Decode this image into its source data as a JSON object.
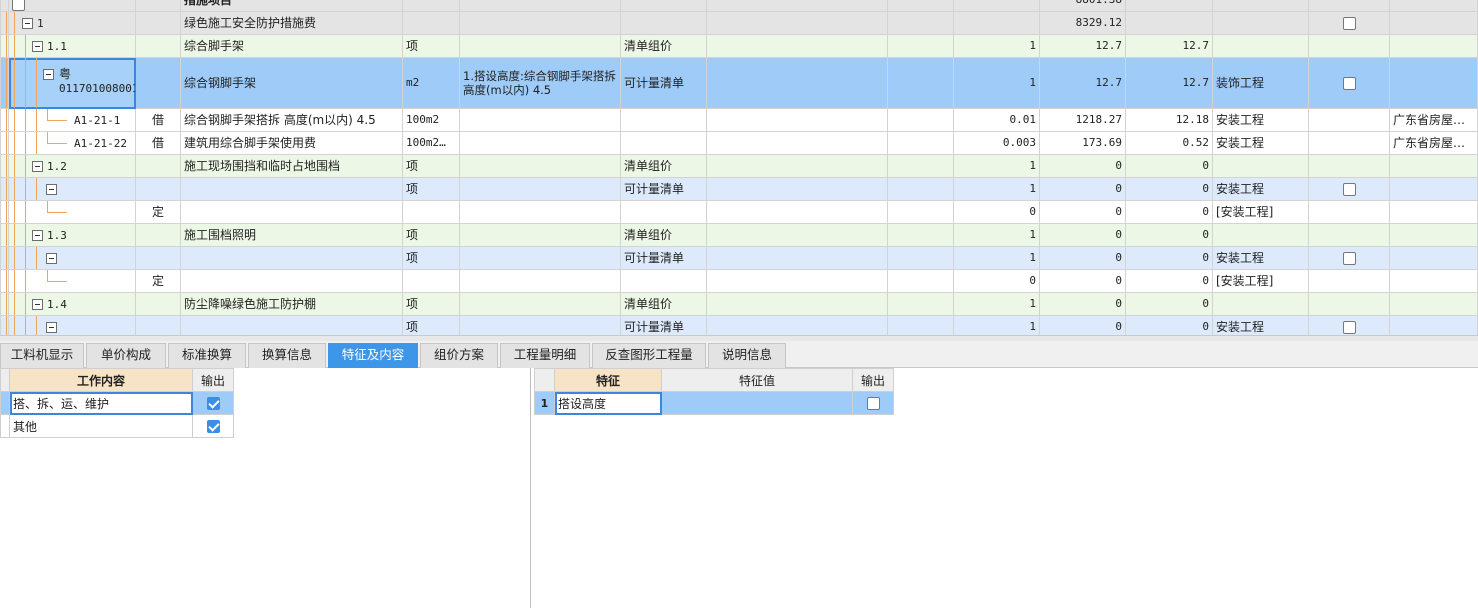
{
  "main_grid": {
    "header_row": {
      "name": "措施项目",
      "total": "8801.38"
    },
    "rows": [
      {
        "code": "1",
        "type": "",
        "name": "绿色施工安全防护措施费",
        "unit": "",
        "feature": "",
        "category": "",
        "qty": "",
        "price": "",
        "total": "8329.12",
        "discipline": "",
        "checkbox": true
      },
      {
        "code": "1.1",
        "type": "",
        "name": "综合脚手架",
        "unit": "项",
        "feature": "",
        "category": "清单组价",
        "qty": "1",
        "price": "12.7",
        "total": "12.7",
        "discipline": "",
        "checkbox": false
      },
      {
        "code": "粤011701008001",
        "code_line1": "粤",
        "code_line2": "011701008001",
        "type": "",
        "name": "综合钢脚手架",
        "unit": "m2",
        "feature": "1.搭设高度:综合钢脚手架搭拆 高度(m以内) 4.5",
        "category": "可计量清单",
        "qty": "1",
        "price": "12.7",
        "total": "12.7",
        "discipline": "装饰工程",
        "checkbox": true
      },
      {
        "code": "A1-21-1",
        "type": "借",
        "name": "综合钢脚手架搭拆 高度(m以内) 4.5",
        "unit": "100m2",
        "feature": "",
        "category": "",
        "qty": "0.01",
        "price": "1218.27",
        "total": "12.18",
        "discipline": "安装工程",
        "source": "广东省房屋…",
        "checkbox": false
      },
      {
        "code": "A1-21-22",
        "type": "借",
        "name": "建筑用综合脚手架使用费",
        "unit": "100m2…",
        "feature": "",
        "category": "",
        "qty": "0.003",
        "price": "173.69",
        "total": "0.52",
        "discipline": "安装工程",
        "source": "广东省房屋…",
        "checkbox": false
      },
      {
        "code": "1.2",
        "type": "",
        "name": "施工现场围挡和临时占地围档",
        "unit": "项",
        "feature": "",
        "category": "清单组价",
        "qty": "1",
        "price": "0",
        "total": "0",
        "discipline": "",
        "checkbox": false
      },
      {
        "code": "",
        "type": "",
        "name": "",
        "unit": "项",
        "feature": "",
        "category": "可计量清单",
        "qty": "1",
        "price": "0",
        "total": "0",
        "discipline": "安装工程",
        "checkbox": true
      },
      {
        "code": "",
        "type": "定",
        "name": "",
        "unit": "",
        "feature": "",
        "category": "",
        "qty": "0",
        "price": "0",
        "total": "0",
        "discipline": "[安装工程]",
        "checkbox": false
      },
      {
        "code": "1.3",
        "type": "",
        "name": "施工围档照明",
        "unit": "项",
        "feature": "",
        "category": "清单组价",
        "qty": "1",
        "price": "0",
        "total": "0",
        "discipline": "",
        "checkbox": false
      },
      {
        "code": "",
        "type": "",
        "name": "",
        "unit": "项",
        "feature": "",
        "category": "可计量清单",
        "qty": "1",
        "price": "0",
        "total": "0",
        "discipline": "安装工程",
        "checkbox": true
      },
      {
        "code": "",
        "type": "定",
        "name": "",
        "unit": "",
        "feature": "",
        "category": "",
        "qty": "0",
        "price": "0",
        "total": "0",
        "discipline": "[安装工程]",
        "checkbox": false
      },
      {
        "code": "1.4",
        "type": "",
        "name": "防尘降噪绿色施工防护棚",
        "unit": "项",
        "feature": "",
        "category": "清单组价",
        "qty": "1",
        "price": "0",
        "total": "0",
        "discipline": "",
        "checkbox": false
      },
      {
        "code": "",
        "type": "",
        "name": "",
        "unit": "项",
        "feature": "",
        "category": "可计量清单",
        "qty": "1",
        "price": "0",
        "total": "0",
        "discipline": "安装工程",
        "checkbox": true
      }
    ]
  },
  "tabs": [
    "工料机显示",
    "单价构成",
    "标准换算",
    "换算信息",
    "特征及内容",
    "组价方案",
    "工程量明细",
    "反查图形工程量",
    "说明信息"
  ],
  "active_tab": "特征及内容",
  "work_content": {
    "headers": {
      "content": "工作内容",
      "output": "输出"
    },
    "rows": [
      {
        "content": "搭、拆、运、维护",
        "output": true
      },
      {
        "content": "其他",
        "output": true
      }
    ]
  },
  "features": {
    "headers": {
      "feature": "特征",
      "value": "特征值",
      "output": "输出"
    },
    "rows": [
      {
        "num": "1",
        "feature": "搭设高度",
        "value": "",
        "output": false
      }
    ]
  },
  "colors": {
    "accent": "#3d96e8",
    "selected_row": "#9ecbf7",
    "tree_line": "#f2a55a",
    "group_row": "#edf7e6",
    "item_row": "#ddeafc"
  }
}
